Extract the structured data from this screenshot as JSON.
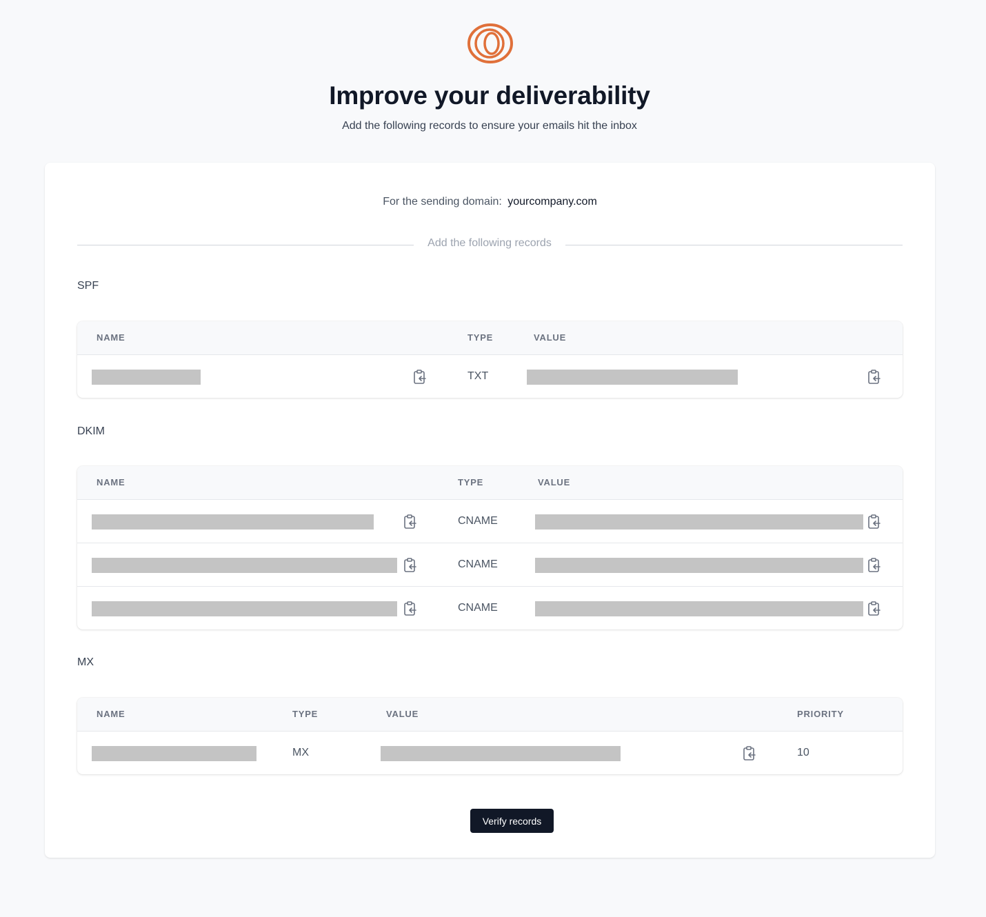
{
  "header": {
    "title": "Improve your deliverability",
    "subtitle": "Add the following records to ensure your emails hit the inbox",
    "logo_icon": "concentric-rings-logo",
    "brand_color": "#e0703a"
  },
  "domain": {
    "label": "For the sending domain:",
    "value": "yourcompany.com"
  },
  "divider_label": "Add the following records",
  "sections": {
    "spf": {
      "label": "SPF",
      "columns": [
        "NAME",
        "TYPE",
        "VALUE"
      ],
      "rows": [
        {
          "name": "",
          "type": "TXT",
          "value": ""
        }
      ]
    },
    "dkim": {
      "label": "DKIM",
      "columns": [
        "NAME",
        "TYPE",
        "VALUE"
      ],
      "rows": [
        {
          "name": "",
          "type": "CNAME",
          "value": ""
        },
        {
          "name": "",
          "type": "CNAME",
          "value": ""
        },
        {
          "name": "",
          "type": "CNAME",
          "value": ""
        }
      ]
    },
    "mx": {
      "label": "MX",
      "columns": [
        "NAME",
        "TYPE",
        "VALUE",
        "PRIORITY"
      ],
      "rows": [
        {
          "name": "",
          "type": "MX",
          "value": "",
          "priority": "10"
        }
      ]
    }
  },
  "icons": {
    "copy": "copy-clipboard-icon"
  },
  "colors": {
    "redacted": "#c4c4c4",
    "button_bg": "#111827"
  },
  "actions": {
    "verify_label": "Verify records"
  }
}
